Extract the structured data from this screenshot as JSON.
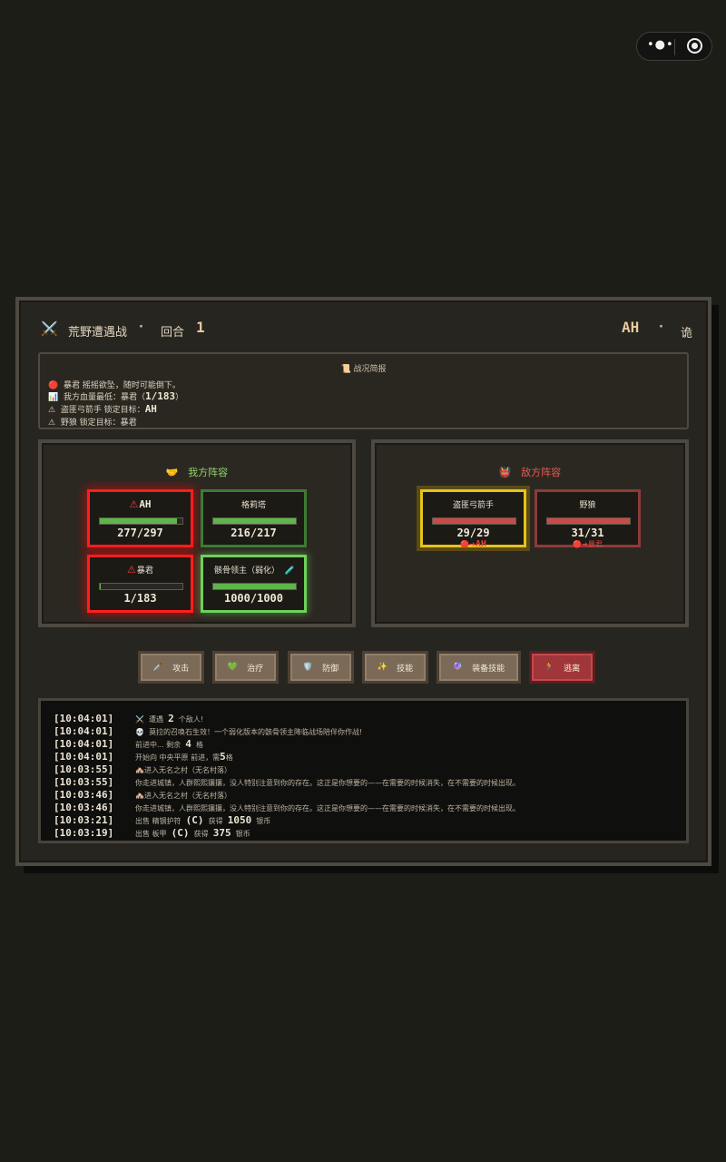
{
  "topbar": {
    "more_icon": "•●•",
    "close_icon": "target"
  },
  "battle": {
    "swords_icon": "⚔️",
    "title": "荒野遭遇战",
    "separator": "·",
    "round_label": "回合",
    "round_number": "1",
    "player_name": "AH",
    "mode": "诡"
  },
  "report": {
    "title": "📜 战况简报",
    "lines": [
      {
        "icon": "🔴",
        "text": "暴君  摇摇欲坠，随时可能倒下。"
      },
      {
        "icon": "📊",
        "pre": "我方血量最低：暴君（",
        "value": "1/183",
        "post": "）"
      },
      {
        "icon": "⚠",
        "pre": "盗匪弓箭手  锁定目标：",
        "value": "AH",
        "post": ""
      },
      {
        "icon": "⚠",
        "text": "野狼  锁定目标：暴君"
      }
    ]
  },
  "ally": {
    "icon": "🤝",
    "title": "我方阵容",
    "cards": [
      {
        "warn": "⚠",
        "name": "AH",
        "hp": "277/297",
        "hp_fraction": 0.93
      },
      {
        "warn": "",
        "name": "格莉塔",
        "hp": "216/217",
        "hp_fraction": 0.995
      },
      {
        "warn": "⚠",
        "name": "暴君",
        "hp": "1/183",
        "hp_fraction": 0.005
      },
      {
        "warn": "",
        "name": "骸骨领主（弱化）",
        "hp": "1000/1000",
        "hp_fraction": 1.0,
        "potion": "🧪"
      }
    ]
  },
  "enemy": {
    "icon": "👹",
    "title": "敌方阵容",
    "cards": [
      {
        "name": "盗匪弓箭手",
        "hp": "29/29",
        "hp_fraction": 1.0,
        "target_prefix": "🔴➜",
        "target": "AH"
      },
      {
        "name": "野狼",
        "hp": "31/31",
        "hp_fraction": 1.0,
        "target_prefix": "🔴➜",
        "target": "暴君"
      }
    ]
  },
  "actions": [
    {
      "icon": "🗡️",
      "label": "攻击"
    },
    {
      "icon": "💚",
      "label": "治疗"
    },
    {
      "icon": "🛡️",
      "label": "防御"
    },
    {
      "icon": "✨",
      "label": "技能"
    },
    {
      "icon": "🔮",
      "label": "装备技能"
    },
    {
      "icon": "🏃",
      "label": "逃离"
    }
  ],
  "log": [
    {
      "ts": "[10:04:01]",
      "icon": "⚔️",
      "pre": "遭遇",
      "num": "2",
      "post": "个敌人!"
    },
    {
      "ts": "[10:04:01]",
      "icon": "💀",
      "pre": "莫拉的召唤石生效！一个弱化版本的骸骨领主降临战场陪伴你作战!",
      "num": "",
      "post": ""
    },
    {
      "ts": "[10:04:01]",
      "icon": "",
      "pre": "前进中...  剩余",
      "num": "4",
      "post": "格"
    },
    {
      "ts": "[10:04:01]",
      "icon": "",
      "pre": "开始向  中央平原  前进，需",
      "num": "5",
      "post": "格"
    },
    {
      "ts": "[10:03:55]",
      "icon": "🏘️",
      "pre": "进入无名之村（无名村落）",
      "num": "",
      "post": ""
    },
    {
      "ts": "[10:03:55]",
      "icon": "",
      "pre": "你走进城镇，人群熙熙攘攘，没人特别注意到你的存在。这正是你想要的——在需要的时候消失，在不需要的时候出现。",
      "num": "",
      "post": ""
    },
    {
      "ts": "[10:03:46]",
      "icon": "🏘️",
      "pre": "进入无名之村（无名村落）",
      "num": "",
      "post": ""
    },
    {
      "ts": "[10:03:46]",
      "icon": "",
      "pre": "你走进城镇，人群熙熙攘攘，没人特别注意到你的存在。这正是你想要的——在需要的时候消失，在不需要的时候出现。",
      "num": "",
      "post": ""
    },
    {
      "ts": "[10:03:21]",
      "icon": "",
      "pre": "出售  精钢护符",
      "grade": "(C)",
      "mid": "获得",
      "num": "1050",
      "post": "银币"
    },
    {
      "ts": "[10:03:19]",
      "icon": "",
      "pre": "出售  板甲",
      "grade": "(C)",
      "mid": "获得",
      "num": "375",
      "post": "银币"
    }
  ]
}
